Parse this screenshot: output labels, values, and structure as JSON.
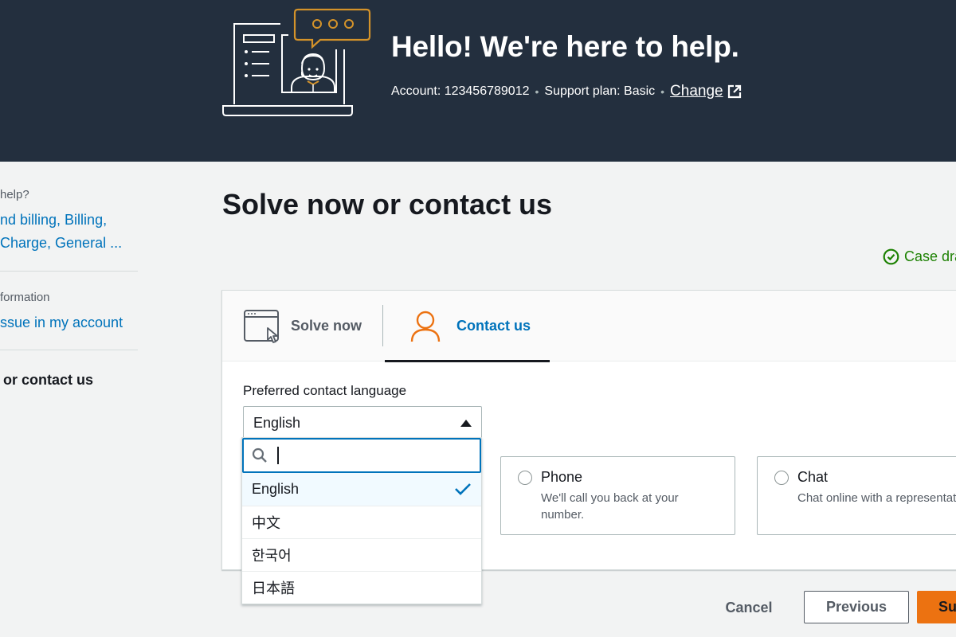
{
  "hero": {
    "title": "Hello!  We're here to help.",
    "account_label": "Account: 123456789012",
    "support_plan_label": "Support plan: Basic",
    "separator": "•",
    "change_link": "Change",
    "illustration": "support-agent-illustration",
    "accent_color": "#d4932a"
  },
  "sidebar": {
    "sections": [
      {
        "label": "help?",
        "link": "nd billing, Billing,",
        "link_line2": "Charge, General ..."
      },
      {
        "label": "formation",
        "link": "ssue in my account"
      }
    ],
    "current": "or contact us"
  },
  "main": {
    "page_title": "Solve now or contact us",
    "draft_status": "Case dra",
    "tabs": [
      {
        "label": "Solve now",
        "icon": "browser-cursor-icon",
        "active": false
      },
      {
        "label": "Contact us",
        "icon": "person-icon",
        "active": true
      }
    ],
    "language": {
      "label": "Preferred contact language",
      "selected": "English",
      "search_placeholder": "",
      "options": [
        {
          "label": "English",
          "selected": true
        },
        {
          "label": "中文",
          "selected": false
        },
        {
          "label": "한국어",
          "selected": false
        },
        {
          "label": "日本語",
          "selected": false
        }
      ]
    },
    "contact_options": [
      {
        "title": "Phone",
        "description": "We'll call you back at your number.",
        "selected": false
      },
      {
        "title": "Chat",
        "description": "Chat online with a representative.",
        "selected": false
      }
    ]
  },
  "footer": {
    "cancel": "Cancel",
    "previous": "Previous",
    "submit": "Su"
  },
  "colors": {
    "header_bg": "#232f3e",
    "link": "#0073bb",
    "success": "#1d8102",
    "primary_button": "#ec7211",
    "contact_icon": "#ec7211"
  }
}
